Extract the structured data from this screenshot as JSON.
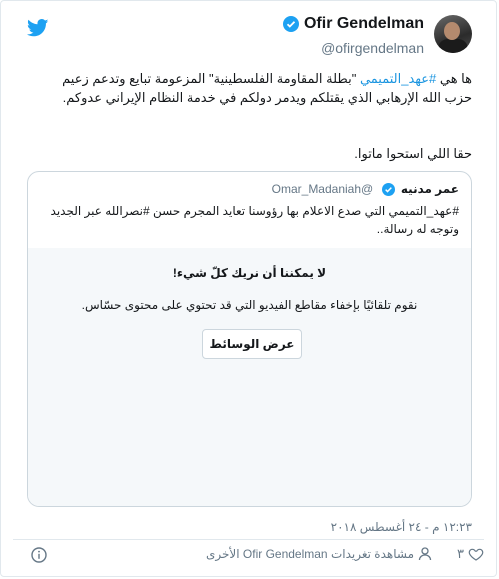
{
  "author": {
    "display_name": "Ofir Gendelman",
    "handle": "@ofirgendelman"
  },
  "tweet": {
    "line1_prefix": "ها هي ",
    "hashtag": "#عهد_التميمي",
    "line1_rest": " \"بطلة المقاومة الفلسطينية\" المزعومة تبايع وتدعم زعيم حزب الله الإرهابي الذي يقتلكم ويدمر دولكم في خدمة النظام الإيراني عدوكم.",
    "line2": "حقا اللي استحوا ماتوا."
  },
  "quote": {
    "name": "عمر مدنيه",
    "handle": "@Omar_Madaniah",
    "text": "#عهد_التميمي التي صدع الاعلام بها رؤوسنا تعايد المجرم حسن #نصرالله عبر الجديد وتوجه له رسالة..",
    "sensitive_title": "لا يمكننا أن نريك كلّ شيء!",
    "sensitive_body": "نقوم تلقائيًا بإخفاء مقاطع الفيديو التي قد تحتوي على محتوى حسّاس.",
    "view_button": "عرض الوسائط"
  },
  "timestamp": "١٢:٢٣ م - ٢٤ أغسطس ٢٠١٨",
  "footer": {
    "like_count": "٣",
    "activity_text": "مشاهدة تغريدات Ofir Gendelman الأخرى"
  },
  "icons": {
    "logo": "twitter-bird-icon",
    "verified": "verified-badge-icon",
    "heart": "heart-icon",
    "person": "person-icon",
    "info": "info-icon"
  },
  "colors": {
    "brand": "#1da1f2",
    "hashtag": "#1b95e0",
    "muted": "#657786",
    "border": "#ccd6dd",
    "sensitive_bg": "#f5f8fa"
  }
}
